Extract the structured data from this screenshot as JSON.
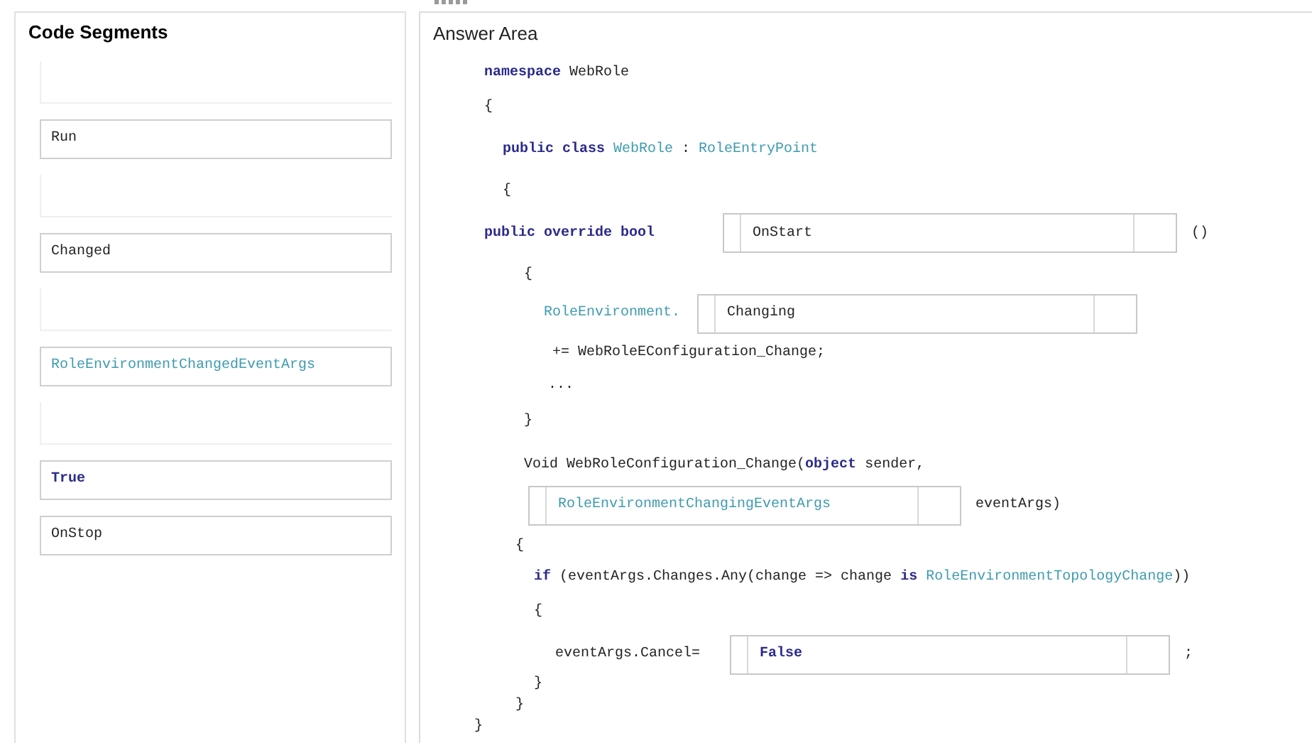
{
  "segments_panel": {
    "title": "Code Segments",
    "segments": [
      {
        "kind": "empty"
      },
      {
        "kind": "plain",
        "text": "Run"
      },
      {
        "kind": "empty"
      },
      {
        "kind": "plain",
        "text": "Changed"
      },
      {
        "kind": "empty"
      },
      {
        "kind": "type",
        "text": "RoleEnvironmentChangedEventArgs"
      },
      {
        "kind": "empty"
      },
      {
        "kind": "keyword",
        "text": "True"
      },
      {
        "kind": "plain",
        "text": "OnStop"
      }
    ]
  },
  "answer_area": {
    "title": "Answer Area",
    "lines": [
      [
        {
          "kind": "keyword",
          "text": "namespace"
        },
        {
          "kind": "plain",
          "text": "WebRole"
        }
      ],
      [
        {
          "kind": "plain",
          "text": "{"
        }
      ],
      [
        {
          "kind": "keyword",
          "text": "public class"
        },
        {
          "kind": "type",
          "text": "WebRole"
        },
        {
          "kind": "plain",
          "text": ":"
        },
        {
          "kind": "type",
          "text": "RoleEntryPoint"
        }
      ],
      [
        {
          "kind": "plain",
          "text": "{"
        }
      ],
      [
        {
          "kind": "keyword",
          "text": "public override bool"
        },
        {
          "kind": "drop",
          "segment": {
            "kind": "plain",
            "text": "OnStart"
          }
        },
        {
          "kind": "plain",
          "text": "()"
        }
      ],
      [
        {
          "kind": "plain",
          "text": "{"
        }
      ],
      [
        {
          "kind": "type",
          "text": "RoleEnvironment."
        },
        {
          "kind": "drop",
          "segment": {
            "kind": "plain",
            "text": "Changing"
          }
        }
      ],
      [
        {
          "kind": "plain",
          "text": "+= WebRoleEConfiguration_Change;"
        }
      ],
      [
        {
          "kind": "plain",
          "text": "..."
        }
      ],
      [
        {
          "kind": "plain",
          "text": "}"
        }
      ],
      [
        {
          "kind": "call",
          "text": "Void WebRoleConfiguration_Change("
        },
        {
          "kind": "keyword",
          "text": "object"
        },
        {
          "kind": "plain",
          "text": "sender,"
        }
      ],
      [
        {
          "kind": "drop",
          "segment": {
            "kind": "type",
            "text": "RoleEnvironmentChangingEventArgs"
          }
        },
        {
          "kind": "plain",
          "text": "eventArgs)"
        }
      ],
      [
        {
          "kind": "plain",
          "text": "{"
        }
      ],
      [
        {
          "kind": "keyword",
          "text": "if"
        },
        {
          "kind": "plain",
          "text": "(eventArgs.Changes.Any(change => change"
        },
        {
          "kind": "keyword",
          "text": "is"
        },
        {
          "kind": "type",
          "text": "RoleEnvironmentTopologyChange"
        },
        {
          "kind": "closing",
          "text": "))"
        }
      ],
      [
        {
          "kind": "plain",
          "text": "{"
        }
      ],
      [
        {
          "kind": "plain",
          "text": "eventArgs.Cancel="
        },
        {
          "kind": "drop",
          "segment": {
            "kind": "keyword",
            "text": "False"
          }
        },
        {
          "kind": "plain",
          "text": ";"
        }
      ],
      [
        {
          "kind": "plain",
          "text": "}"
        }
      ],
      [
        {
          "kind": "plain",
          "text": "}"
        }
      ],
      [
        {
          "kind": "plain",
          "text": "}"
        }
      ]
    ]
  }
}
